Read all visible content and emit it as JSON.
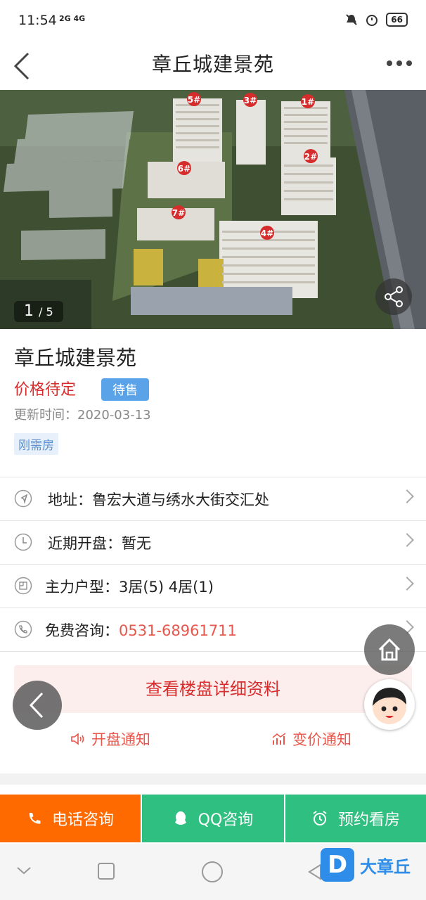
{
  "status_bar": {
    "time": "11:54",
    "network": "2G 4G",
    "battery": "66"
  },
  "nav": {
    "title": "章丘城建景苑",
    "back_icon": "chevron-left-icon",
    "more_icon": "more-dots-icon"
  },
  "hero": {
    "counter_current": "1",
    "counter_total": "/ 5",
    "building_labels": [
      "5#",
      "3#",
      "1#",
      "2#",
      "6#",
      "7#",
      "4#"
    ]
  },
  "project": {
    "title": "章丘城建景苑",
    "price": "价格待定",
    "sale_status": "待售",
    "update_label": "更新时间：",
    "update_date": "2020-03-13",
    "tag": "刚需房"
  },
  "rows": [
    {
      "icon": "location-icon",
      "label": "地址：",
      "value": "鲁宏大道与绣水大街交汇处"
    },
    {
      "icon": "clock-icon",
      "label": "近期开盘：",
      "value": "暂无"
    },
    {
      "icon": "floorplan-icon",
      "label": "主力户型：",
      "value": "3居(5) 4居(1)"
    },
    {
      "icon": "phone-icon",
      "label": "免费咨询：",
      "value": "0531-68961711"
    }
  ],
  "detail_button": "查看楼盘详细资料",
  "notify": {
    "opening": "开盘通知",
    "price_change": "变价通知"
  },
  "actions": {
    "call": "电话咨询",
    "qq": "QQ咨询",
    "visit": "预约看房"
  },
  "watermark": {
    "logo": "D",
    "text": "大章丘"
  },
  "colors": {
    "accent_red": "#d62c2c",
    "phone": "#e8574c",
    "call_bg": "#ff6a00",
    "green_bg": "#2fbf80",
    "badge_blue": "#5ba3e8"
  }
}
